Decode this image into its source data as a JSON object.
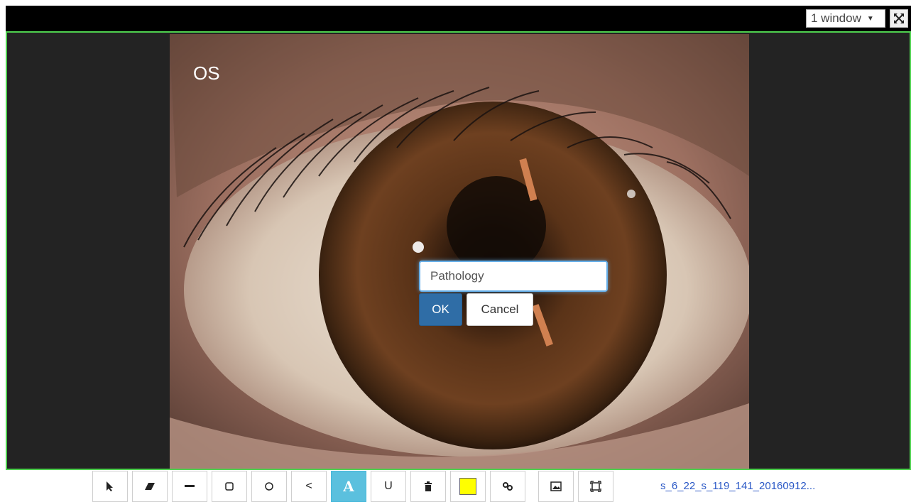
{
  "header": {
    "layout_select_value": "1 window",
    "fullscreen_icon": "fullscreen-icon"
  },
  "viewer": {
    "eye_label": "OS",
    "border_color": "#4fd14f"
  },
  "dialog": {
    "input_value": "Pathology",
    "ok_label": "OK",
    "cancel_label": "Cancel"
  },
  "toolbar": {
    "tools": [
      {
        "name": "pointer-tool",
        "icon": "cursor-icon"
      },
      {
        "name": "eraser-tool",
        "icon": "eraser-icon"
      },
      {
        "name": "line-tool",
        "icon": "line-icon"
      },
      {
        "name": "rectangle-tool",
        "icon": "square-icon"
      },
      {
        "name": "circle-tool",
        "icon": "circle-icon"
      },
      {
        "name": "angle-tool",
        "icon": "angle-icon",
        "glyph": "<"
      },
      {
        "name": "text-tool",
        "icon": "text-icon",
        "glyph": "A",
        "active": true
      },
      {
        "name": "freehand-tool",
        "icon": "u-shape-icon",
        "glyph": "U"
      },
      {
        "name": "delete-tool",
        "icon": "trash-icon"
      },
      {
        "name": "color-tool",
        "icon": "color-swatch-icon",
        "color": "#ffff00"
      },
      {
        "name": "link-tool",
        "icon": "link-icon"
      },
      {
        "name": "image-tool",
        "icon": "image-icon"
      },
      {
        "name": "fit-tool",
        "icon": "fit-screen-icon"
      }
    ],
    "filename": "s_6_22_s_119_141_20160912..."
  }
}
